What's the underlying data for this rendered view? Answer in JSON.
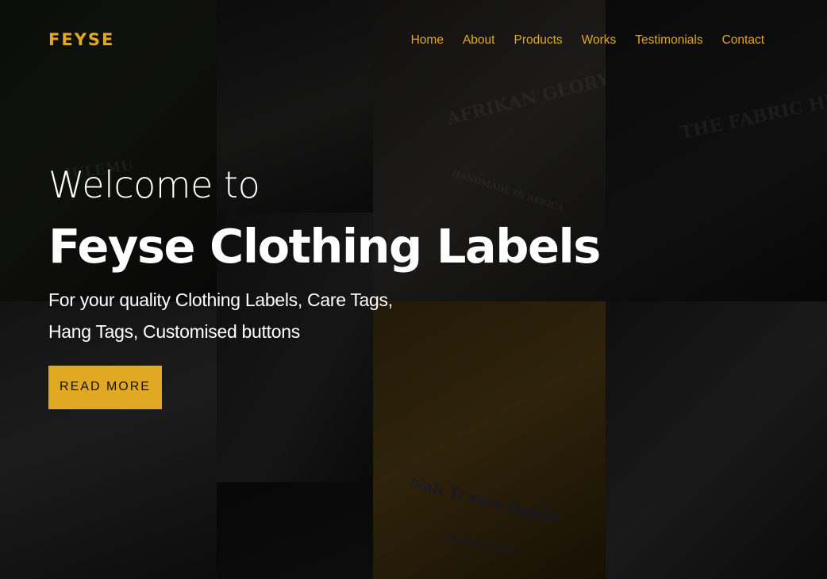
{
  "brand": {
    "logo": "FEYSE",
    "accent_color": "#e0a823"
  },
  "nav": {
    "items": [
      {
        "label": "Home"
      },
      {
        "label": "About"
      },
      {
        "label": "Products"
      },
      {
        "label": "Works"
      },
      {
        "label": "Testimonials"
      },
      {
        "label": "Contact"
      }
    ]
  },
  "hero": {
    "welcome": "Welcome to",
    "headline": "Feyse Clothing Labels",
    "subtitle_line1": "For your quality Clothing Labels, Care Tags,",
    "subtitle_line2": "Hang Tags, Customised buttons",
    "cta_label": "READ MORE"
  },
  "background": {
    "label_texts": {
      "julemu": "JULEMU",
      "afrikan_glory": "AFRIKAN GLORY",
      "handmade": "HANDMADE IN AFRICA",
      "fabric_hub": "THE FABRIC HUB",
      "nah_traore": "Nah Traore @gobi",
      "phone": "+16464023994"
    }
  }
}
